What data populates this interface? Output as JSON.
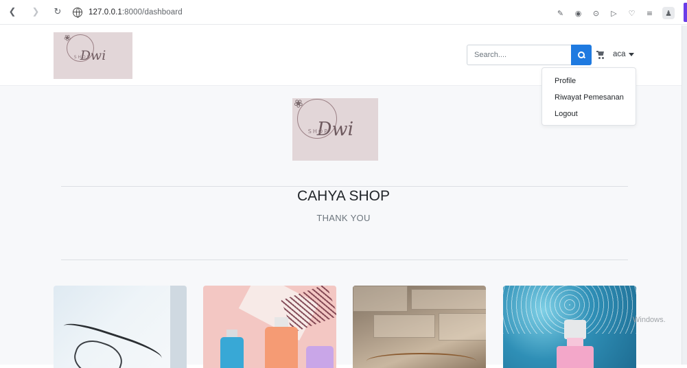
{
  "browser": {
    "url_host": "127.0.0.1",
    "url_path": ":8000/dashboard",
    "nav_icons": [
      "back-icon",
      "forward-icon",
      "reload-icon",
      "site-info-icon"
    ],
    "tool_icons": [
      "edit-icon",
      "screenshot-icon",
      "download-icon",
      "play-icon",
      "favorite-icon",
      "reading-list-icon",
      "profile-icon"
    ],
    "accent_color": "#6a3de8"
  },
  "navbar": {
    "logo": {
      "script": "Dwi",
      "sub": "SHOP"
    },
    "search_placeholder": "Search....",
    "search_button_color": "#1f7ae0",
    "user_name": "aca"
  },
  "user_menu": {
    "items": [
      "Profile",
      "Riwayat Pemesanan",
      "Logout"
    ]
  },
  "hero": {
    "logo": {
      "script": "Dwi",
      "sub": "SHOP"
    },
    "title": "CAHYA SHOP",
    "subtitle": "THANK YOU"
  },
  "products": [
    {
      "image": "eyeglasses"
    },
    {
      "image": "perfume-bottles"
    },
    {
      "image": "glasses-on-stone"
    },
    {
      "image": "pink-perfume-sea"
    }
  ],
  "watermark": "Windows."
}
